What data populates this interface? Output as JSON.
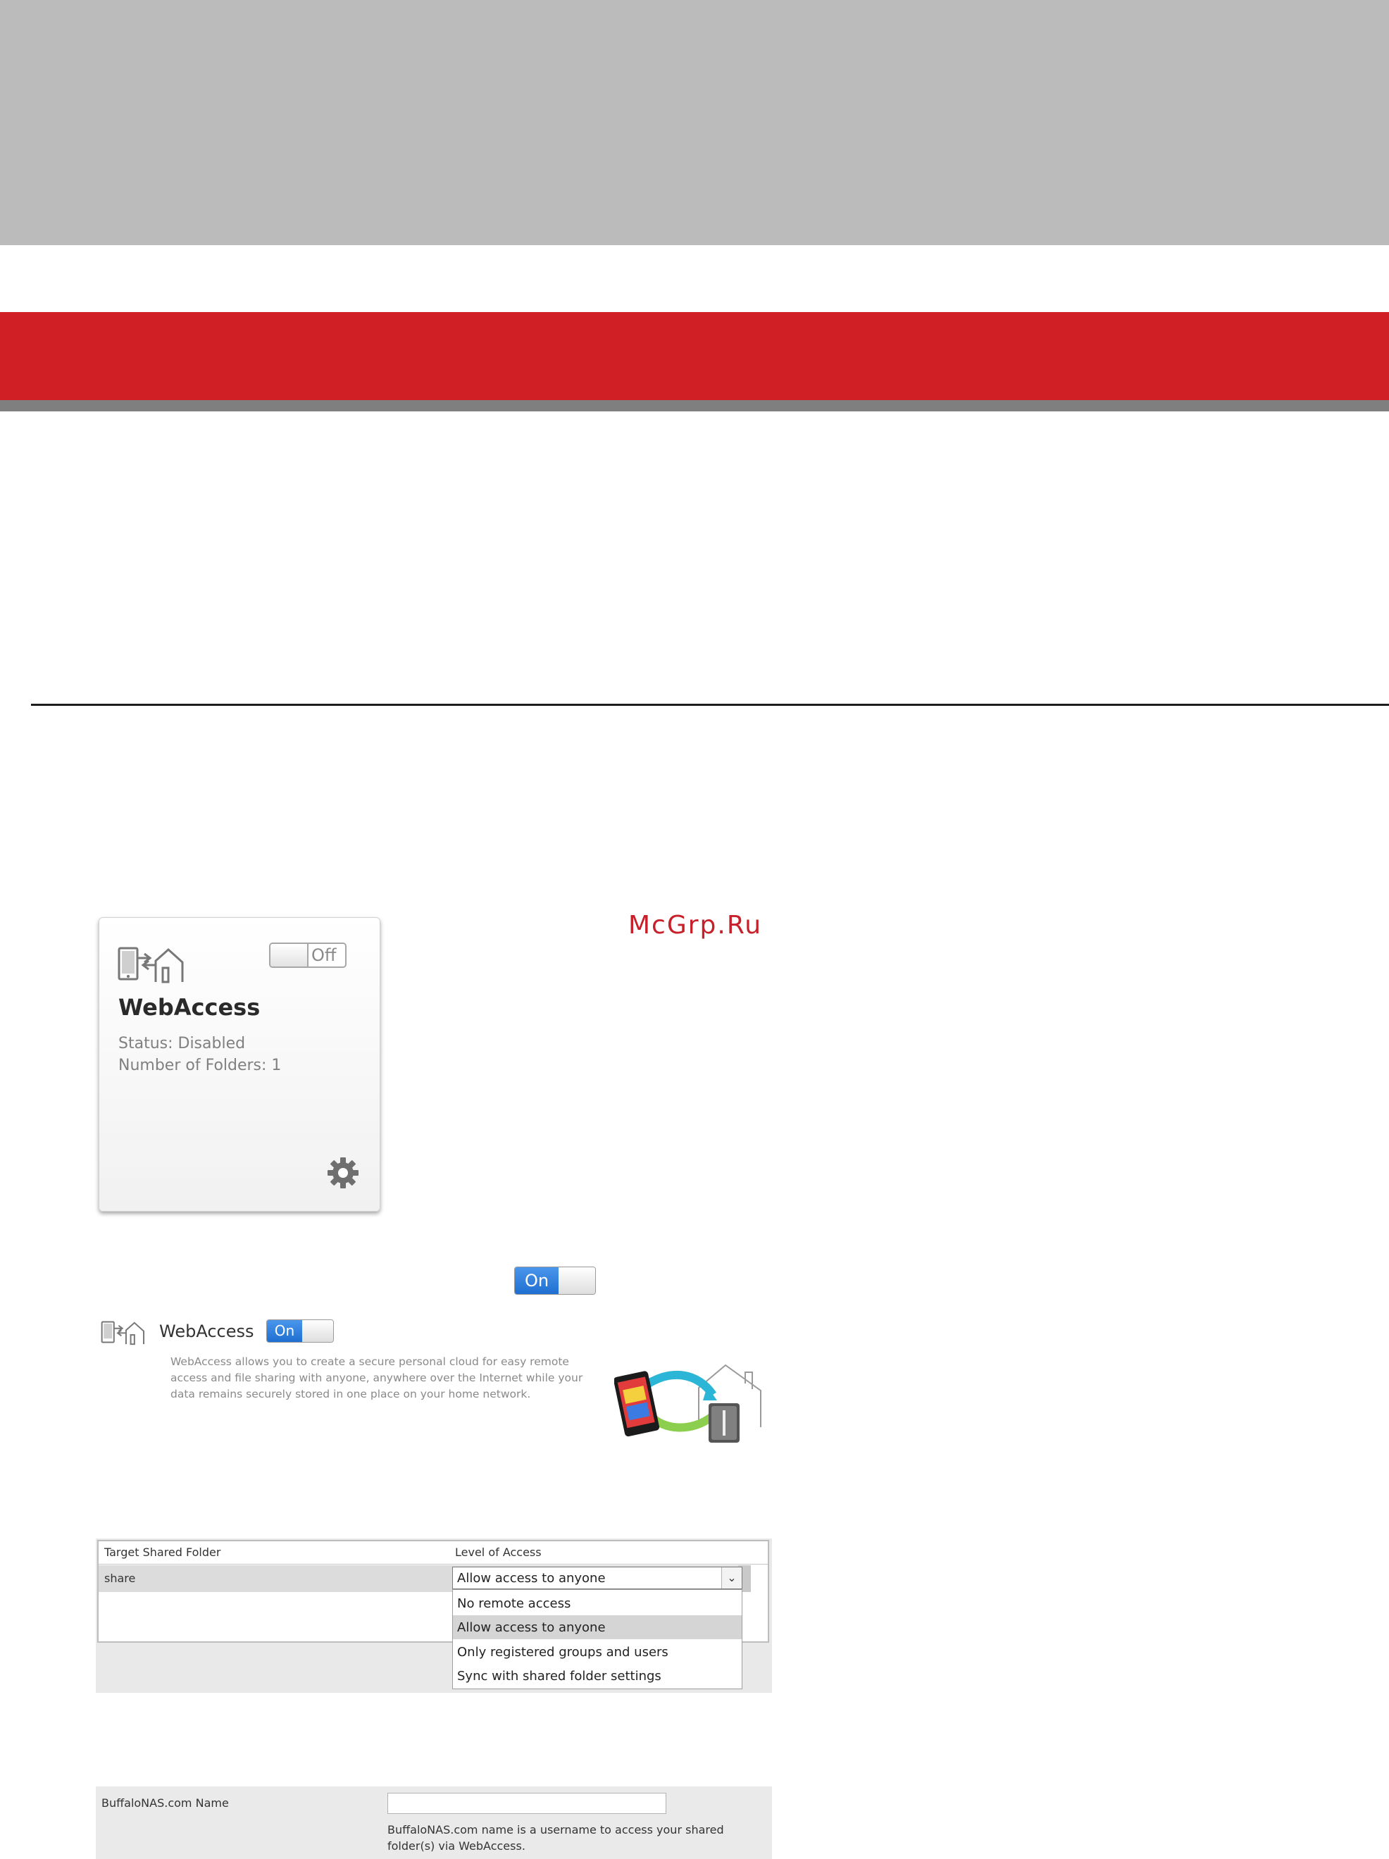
{
  "watermark": "McGrp.Ru",
  "card": {
    "title": "WebAccess",
    "status": "Status: Disabled",
    "folders": "Number of Folders: 1",
    "toggle_label": "Off"
  },
  "toggle_on_label": "On",
  "webaccess_row": {
    "label": "WebAccess",
    "toggle_label": "On",
    "description": "WebAccess allows you to create a secure personal cloud for easy remote access and file sharing with anyone, anywhere over the Internet while your data remains securely stored in one place on your home network."
  },
  "table": {
    "headers": [
      "Target Shared Folder",
      "Level of Access"
    ],
    "rows": [
      {
        "folder": "share",
        "access": "Allow access to anyone"
      }
    ],
    "options": [
      "No remote access",
      "Allow access to anyone",
      "Only registered groups and users",
      "Sync with shared folder settings"
    ],
    "selected_index": 1
  },
  "nas": {
    "label": "BuffaloNAS.com Name",
    "input_value": "",
    "help": "BuffaloNAS.com name is a username to access your shared folder(s) via WebAccess."
  },
  "colors": {
    "header_gray": "#bbbbbb",
    "brand_red": "#d01f25",
    "toggle_blue": "#1f6fd1"
  }
}
